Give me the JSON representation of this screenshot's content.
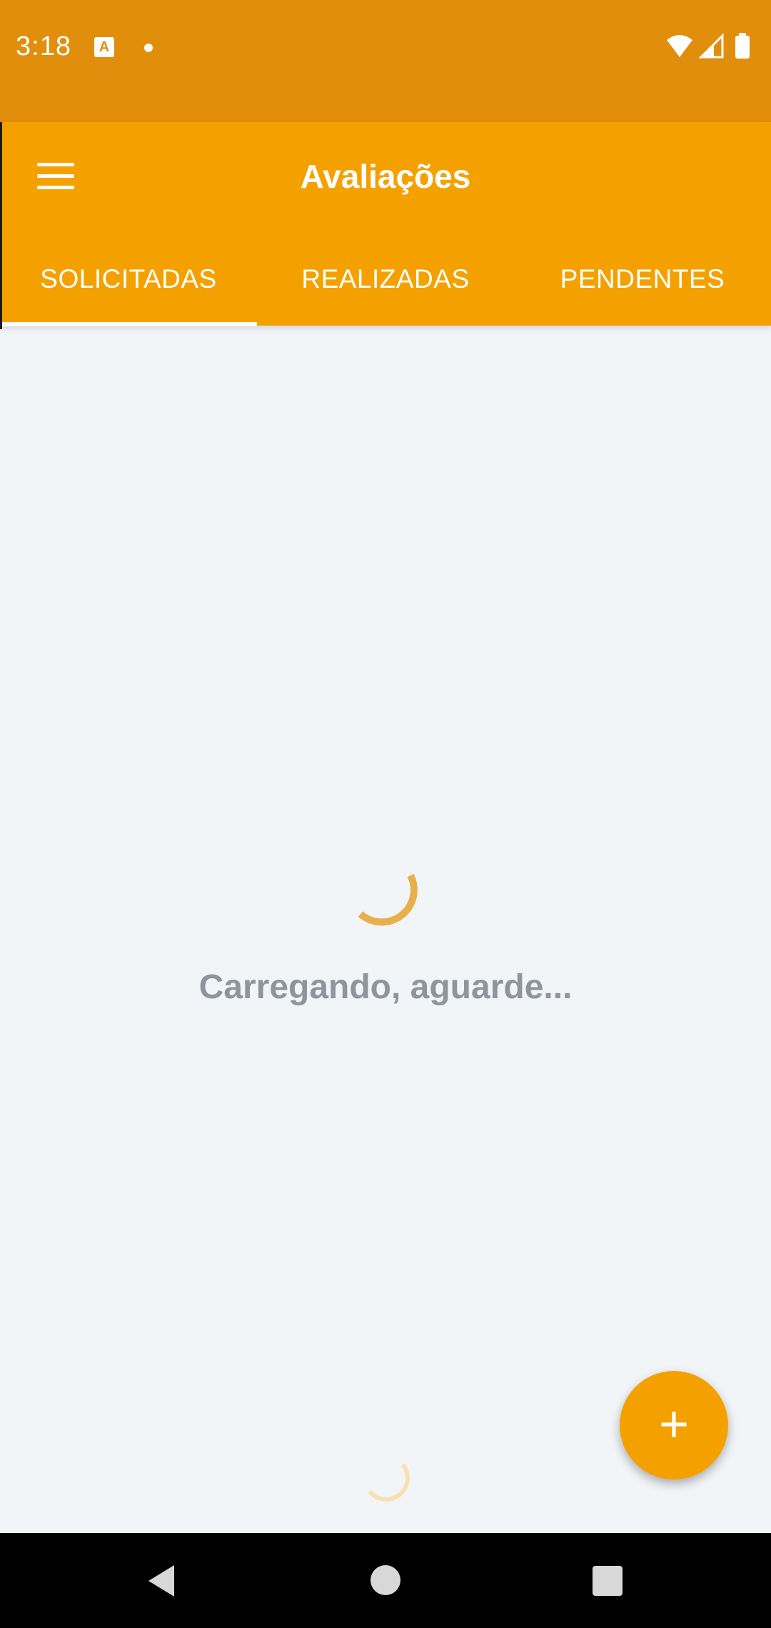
{
  "status_bar": {
    "time": "3:18",
    "notification_icon_letter": "A",
    "icons": [
      "wifi-icon",
      "cellular-signal-icon",
      "battery-icon"
    ],
    "background_color": "#e08e0b"
  },
  "app_bar": {
    "title": "Avaliações",
    "menu_icon": "hamburger-menu-icon",
    "background_color": "#f4a100"
  },
  "tabs": [
    {
      "label": "SOLICITADAS",
      "selected": true
    },
    {
      "label": "REALIZADAS",
      "selected": false
    },
    {
      "label": "PENDENTES",
      "selected": false
    }
  ],
  "content": {
    "loading_text": "Carregando, aguarde...",
    "spinner_color": "#e8b04c"
  },
  "fab": {
    "label": "+",
    "icon": "plus-icon"
  },
  "nav_bar": {
    "icons": [
      "back-icon",
      "home-icon",
      "recents-icon"
    ]
  }
}
